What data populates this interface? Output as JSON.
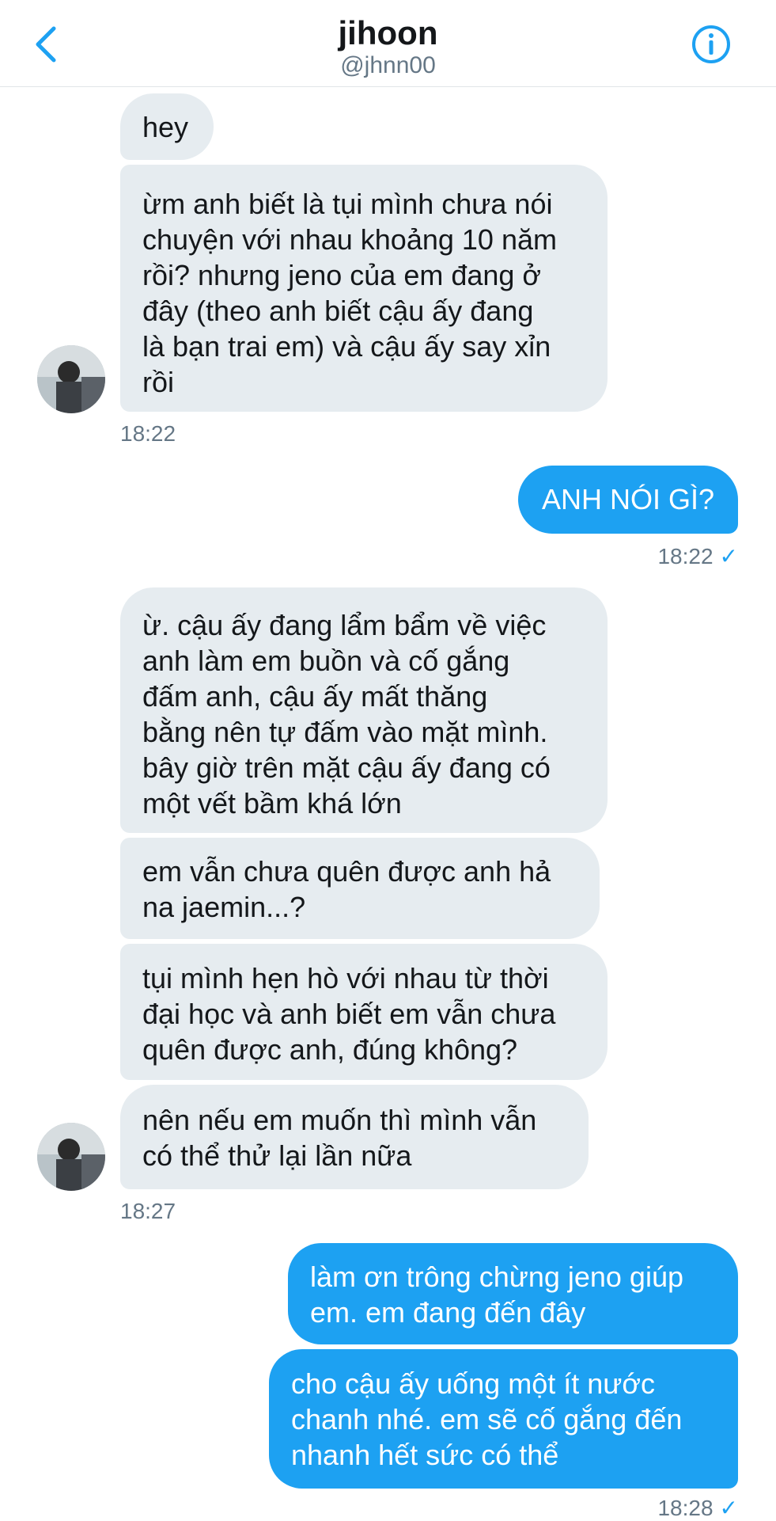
{
  "header": {
    "name": "jihoon",
    "handle": "@jhnn00"
  },
  "icons": {
    "back": "chevron-left-icon",
    "info": "info-circle-icon",
    "accent": "#1da1f2"
  },
  "messages": [
    {
      "dir": "in",
      "text": "hey"
    },
    {
      "dir": "in",
      "text": "ừm anh biết là tụi mình chưa nói\nchuyện với nhau khoảng 10 năm\nrồi? nhưng jeno của em đang ở\nđây (theo anh biết cậu ấy đang\nlà bạn trai em) và cậu ấy say xỉn\nrồi"
    },
    {
      "dir": "out",
      "text": "ANH NÓI GÌ?"
    },
    {
      "dir": "in",
      "text": "ừ. cậu ấy đang lẩm bẩm về việc\nanh làm em buồn và cố gắng\nđấm anh, cậu ấy mất thăng\nbằng nên tự đấm vào mặt mình.\nbây giờ trên mặt cậu ấy đang có\nmột vết bầm khá lớn"
    },
    {
      "dir": "in",
      "text": "em vẫn chưa quên được anh hả\nna jaemin...?"
    },
    {
      "dir": "in",
      "text": "tụi mình hẹn hò với nhau từ thời\nđại học và anh biết em vẫn chưa\nquên được anh, đúng không?"
    },
    {
      "dir": "in",
      "text": "nên nếu em muốn thì mình vẫn\ncó thể thử lại lần nữa"
    },
    {
      "dir": "out",
      "text": "làm ơn trông chừng jeno giúp\nem. em đang đến đây"
    },
    {
      "dir": "out",
      "text": "cho cậu ấy uống một ít nước\nchanh nhé. em sẽ cố gắng đến\nnhanh hết sức có thể"
    }
  ],
  "timestamps": {
    "t1": "18:22",
    "t2": "18:22",
    "t3": "18:27",
    "t4": "18:28"
  },
  "read_mark": "✓"
}
